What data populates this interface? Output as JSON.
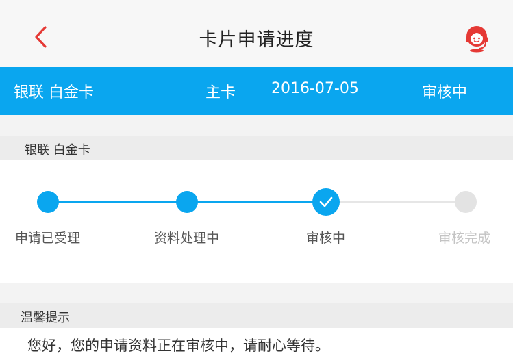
{
  "header": {
    "title": "卡片申请进度"
  },
  "icons": {
    "back": "chevron-left-icon",
    "service": "customer-service-icon"
  },
  "colors": {
    "accent": "#0aa6ef",
    "brand_red": "#e53935",
    "pending": "#e3e3e3"
  },
  "card": {
    "name": "银联 白金卡",
    "type": "主卡",
    "date": "2016-07-05",
    "status": "审核中"
  },
  "progress": {
    "section_title": "银联 白金卡",
    "steps": [
      {
        "label": "申请已受理",
        "state": "done"
      },
      {
        "label": "资料处理中",
        "state": "done"
      },
      {
        "label": "审核中",
        "state": "current"
      },
      {
        "label": "审核完成",
        "state": "pending"
      }
    ]
  },
  "tips": {
    "section_title": "温馨提示",
    "message": "您好，您的申请资料正在审核中，请耐心等待。"
  }
}
